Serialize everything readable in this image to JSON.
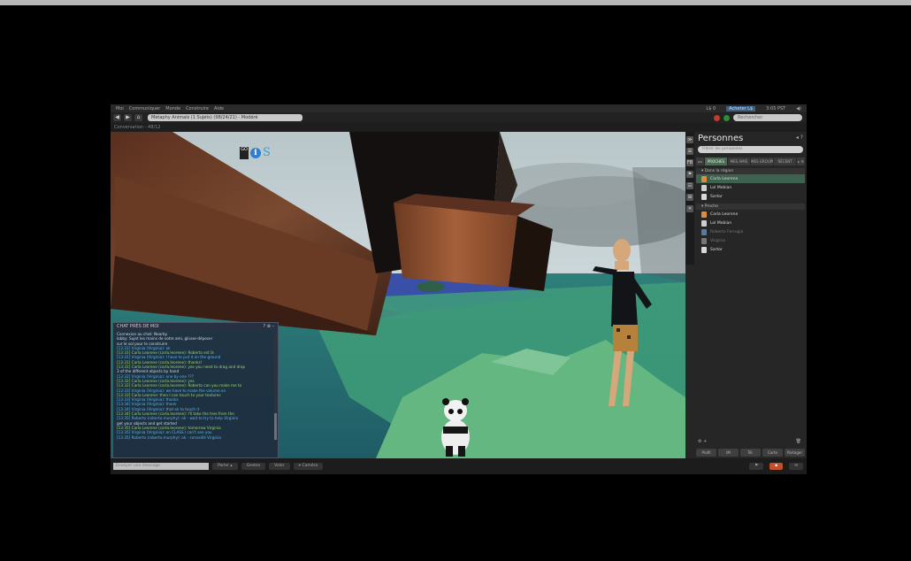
{
  "menu": {
    "items": [
      "Moi",
      "Communiquer",
      "Monde",
      "Construire",
      "Aide"
    ],
    "status": [
      "L$ 0",
      "Acheter L$",
      "3:05 PST"
    ]
  },
  "nav": {
    "back": "◀",
    "forward": "▶",
    "home": "⌂",
    "url": "Metaphy Animals (1 Sujets) (98/24/21) - Modéré",
    "search_placeholder": "Rechercher"
  },
  "location": "Conversation - 48/12",
  "hud": {
    "b1": "GO",
    "b2": "i",
    "b3": "S"
  },
  "chat": {
    "title": "CHAT PRÈS DE MOI",
    "controls": "? ⊕ –",
    "lines": [
      {
        "t": "Connexion au chat: Nearby",
        "c": ""
      },
      {
        "t": "lobby: Sujet les mains de votre ami, glisser-déposer",
        "c": ""
      },
      {
        "t": "sur le sol pour le construire",
        "c": ""
      },
      {
        "t": "[13:31] Virginia (Virginia): ok",
        "c": "n"
      },
      {
        "t": "[13:31] Carla Leorene (carla.leorene): Roberto est là",
        "c": "n2"
      },
      {
        "t": "[13:31] Virginia (Virginia): I have to put it on the ground",
        "c": "n"
      },
      {
        "t": "[13:31] Carla Leorene (carla.leorene): thanks!",
        "c": "n2"
      },
      {
        "t": "[13:31] Carla Leorene (carla.leorene): yes you need to drag and drop",
        "c": "n2"
      },
      {
        "t": "3 of the different objects by hand",
        "c": ""
      },
      {
        "t": "[13:32] Virginia (Virginia): one by one ???",
        "c": "n"
      },
      {
        "t": "[13:32] Carla Leorene (carla.leorene): yes",
        "c": "n2"
      },
      {
        "t": "[13:32] Carla Leorene (carla.leorene): Roberto can you make me to",
        "c": "n2"
      },
      {
        "t": "[13:33] Virginia (Virginia): we have to make the volume on",
        "c": "n"
      },
      {
        "t": "[13:33] Carla Leorene: then I can touch to your textures",
        "c": "n2"
      },
      {
        "t": "[13:33] Virginia (Virginia): thanks",
        "c": "n"
      },
      {
        "t": "[13:34] Virginia (Virginia): thank",
        "c": "n"
      },
      {
        "t": "[13:34] Virginia (Virginia): that ok to touch it",
        "c": "n"
      },
      {
        "t": "[13:34] Carla Leorene (carla.leorene): I'll take the tree from the",
        "c": "n2"
      },
      {
        "t": "[13:35] Roberto (roberto.murphy): ok - wait to try to help Virginia",
        "c": "n"
      },
      {
        "t": "get your objects and get started",
        "c": ""
      },
      {
        "t": "[13:35] Carla Leorene (carla.leorene): tomorrow Virginia",
        "c": "n2"
      },
      {
        "t": "[13:35] Virginia (Virginia): on CLASS I can't see you",
        "c": "n"
      },
      {
        "t": "[13:35] Roberto (roberto.murphy): ok - conseillé Virginia",
        "c": "n"
      }
    ]
  },
  "sidebar": {
    "icons": [
      "≫",
      "☰",
      "FB",
      "⚑",
      "☷",
      "⊞",
      "✕"
    ],
    "title": "Personnes",
    "title_ctl": "◂ ?",
    "filter_placeholder": "Filtrer les personnes",
    "tabs": [
      "◂ ▸",
      "PROCHES",
      "MES AMIS",
      "MES GROUPES",
      "RÉCENT",
      "▸ ⚙"
    ],
    "groups": [
      "▾ Dans la région",
      "▾ Proche"
    ],
    "people_region": [
      {
        "name": "Carla Leorene",
        "color": "#e08a3a",
        "sel": true
      },
      {
        "name": "Lol Mobian",
        "color": "#cfcfcf",
        "sel": false
      },
      {
        "name": "Sartor",
        "color": "#d8d8d8",
        "sel": false
      }
    ],
    "people_near": [
      {
        "name": "Carla Leorene",
        "color": "#e08a3a",
        "dim": false
      },
      {
        "name": "Lol Mobian",
        "color": "#cfcfcf",
        "dim": false
      },
      {
        "name": "Roberto Ferrugia",
        "color": "#5a78a0",
        "dim": true
      },
      {
        "name": "Virginia",
        "color": "#777",
        "dim": true
      },
      {
        "name": "Sartor",
        "color": "#d8d8d8",
        "dim": false
      }
    ],
    "footer_left": "⚙ +",
    "footer_right": "🗑",
    "buttons": [
      "Profil",
      "IM",
      "Tél.",
      "Carte",
      "Partager"
    ]
  },
  "bottom": {
    "chat_placeholder": "Envoyer une message",
    "buttons": [
      "Parler ▴",
      "Gestes",
      "Voler",
      "⌖ Caméra"
    ],
    "right": [
      "⚑",
      "▪",
      "✉"
    ]
  }
}
